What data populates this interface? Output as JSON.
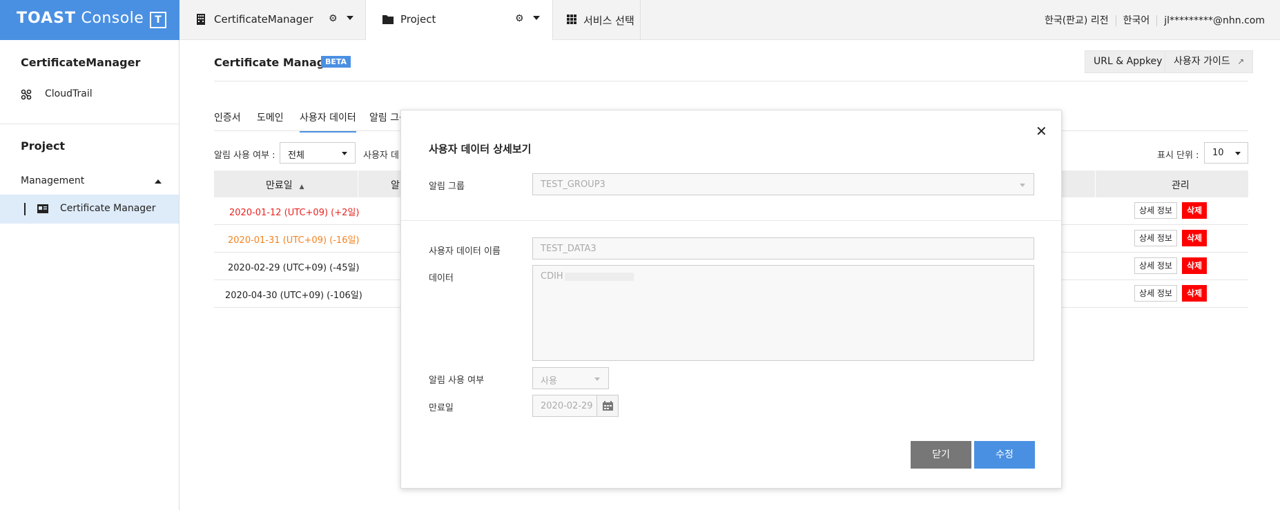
{
  "topbar": {
    "brand_bold": "TOAST",
    "brand_rest": " Console",
    "t_button": "T",
    "tabs": [
      {
        "label": "CertificateManager"
      },
      {
        "label": "Project"
      },
      {
        "label": "서비스 선택"
      }
    ],
    "region": "한국(판교) 리전",
    "language": "한국어",
    "user_email": "jl*********@nhn.com"
  },
  "sidebar": {
    "service_title": "CertificateManager",
    "cloudtrail": "CloudTrail",
    "project_title": "Project",
    "management": "Management",
    "active_item": "Certificate Manager"
  },
  "main": {
    "title": "Certificate Manager",
    "beta": "BETA",
    "url_appkey": "URL & Appkey",
    "user_guide": "사용자 가이드",
    "tabs": [
      "인증서",
      "도메인",
      "사용자 데이터",
      "알림 그룹"
    ],
    "filter_label": "알림 사용 여부 :",
    "filter_value": "전체",
    "filter_label2": "사용자 데",
    "page_size_label": "표시 단위 :",
    "page_size_value": "10",
    "columns": {
      "expiry": "만료일",
      "alarm": "알",
      "manage": "관리"
    },
    "rows": [
      {
        "date": "2020-01-12 (UTC+09) (+2일)",
        "color": "#e8231f"
      },
      {
        "date": "2020-01-31 (UTC+09) (-16일)",
        "color": "#f58220"
      },
      {
        "date": "2020-02-29 (UTC+09) (-45일)",
        "color": "#222222"
      },
      {
        "date": "2020-04-30 (UTC+09) (-106일)",
        "color": "#222222"
      }
    ],
    "detail_btn": "상세 정보",
    "delete_btn": "삭제"
  },
  "modal": {
    "title": "사용자 데이터 상세보기",
    "close_icon": "✕",
    "alarm_group_label": "알림 그룹",
    "alarm_group_value": "TEST_GROUP3",
    "user_data_name_label": "사용자 데이터 이름",
    "user_data_name_value": "TEST_DATA3",
    "data_label": "데이터",
    "data_value": "CDIH",
    "alarm_use_label": "알림 사용 여부",
    "alarm_use_value": "사용",
    "expiry_label": "만료일",
    "expiry_value": "2020-02-29",
    "close_button": "닫기",
    "save_button": "수정"
  },
  "colors": {
    "accent": "#4a90e2",
    "danger": "#ff0000",
    "warning": "#f58220"
  }
}
